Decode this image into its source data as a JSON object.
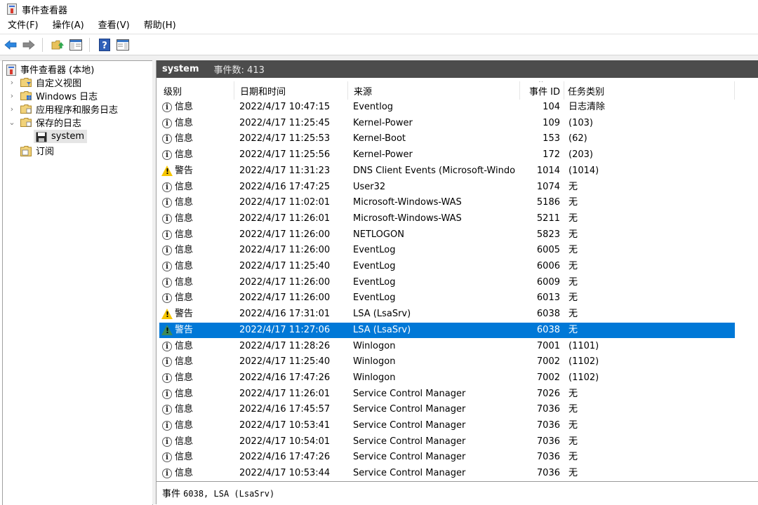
{
  "window": {
    "title": "事件查看器"
  },
  "menu": [
    "文件(F)",
    "操作(A)",
    "查看(V)",
    "帮助(H)"
  ],
  "toolbar": {
    "icons": [
      "back-arrow-icon",
      "forward-arrow-icon",
      "up-folder-icon",
      "show-hide-console-tree-icon",
      "help-icon",
      "show-hide-action-pane-icon"
    ]
  },
  "tree": {
    "root": "事件查看器 (本地)",
    "items": [
      {
        "label": "自定义视图",
        "expander": "›"
      },
      {
        "label": "Windows 日志",
        "expander": "›"
      },
      {
        "label": "应用程序和服务日志",
        "expander": "›"
      },
      {
        "label": "保存的日志",
        "expander": "⌄"
      },
      {
        "label": "system",
        "expander": ""
      },
      {
        "label": "订阅",
        "expander": ""
      }
    ]
  },
  "log_header": {
    "name": "system",
    "count": "事件数: 413"
  },
  "columns": [
    "级别",
    "日期和时间",
    "来源",
    "事件 ID",
    "任务类别"
  ],
  "rows": [
    {
      "level": "信息",
      "type": "info",
      "datetime": "2022/4/17 10:47:15",
      "source": "Eventlog",
      "id": "104",
      "task": "日志清除"
    },
    {
      "level": "信息",
      "type": "info",
      "datetime": "2022/4/17 11:25:45",
      "source": "Kernel-Power",
      "id": "109",
      "task": "(103)"
    },
    {
      "level": "信息",
      "type": "info",
      "datetime": "2022/4/17 11:25:53",
      "source": "Kernel-Boot",
      "id": "153",
      "task": "(62)"
    },
    {
      "level": "信息",
      "type": "info",
      "datetime": "2022/4/17 11:25:56",
      "source": "Kernel-Power",
      "id": "172",
      "task": "(203)"
    },
    {
      "level": "警告",
      "type": "warn",
      "datetime": "2022/4/17 11:31:23",
      "source": "DNS Client Events (Microsoft-Windo...",
      "id": "1014",
      "task": "(1014)"
    },
    {
      "level": "信息",
      "type": "info",
      "datetime": "2022/4/16 17:47:25",
      "source": "User32",
      "id": "1074",
      "task": "无"
    },
    {
      "level": "信息",
      "type": "info",
      "datetime": "2022/4/17 11:02:01",
      "source": "Microsoft-Windows-WAS",
      "id": "5186",
      "task": "无"
    },
    {
      "level": "信息",
      "type": "info",
      "datetime": "2022/4/17 11:26:01",
      "source": "Microsoft-Windows-WAS",
      "id": "5211",
      "task": "无"
    },
    {
      "level": "信息",
      "type": "info",
      "datetime": "2022/4/17 11:26:00",
      "source": "NETLOGON",
      "id": "5823",
      "task": "无"
    },
    {
      "level": "信息",
      "type": "info",
      "datetime": "2022/4/17 11:26:00",
      "source": "EventLog",
      "id": "6005",
      "task": "无"
    },
    {
      "level": "信息",
      "type": "info",
      "datetime": "2022/4/17 11:25:40",
      "source": "EventLog",
      "id": "6006",
      "task": "无"
    },
    {
      "level": "信息",
      "type": "info",
      "datetime": "2022/4/17 11:26:00",
      "source": "EventLog",
      "id": "6009",
      "task": "无"
    },
    {
      "level": "信息",
      "type": "info",
      "datetime": "2022/4/17 11:26:00",
      "source": "EventLog",
      "id": "6013",
      "task": "无"
    },
    {
      "level": "警告",
      "type": "warn",
      "datetime": "2022/4/16 17:31:01",
      "source": "LSA (LsaSrv)",
      "id": "6038",
      "task": "无"
    },
    {
      "level": "警告",
      "type": "warn",
      "datetime": "2022/4/17 11:27:06",
      "source": "LSA (LsaSrv)",
      "id": "6038",
      "task": "无",
      "selected": true
    },
    {
      "level": "信息",
      "type": "info",
      "datetime": "2022/4/17 11:28:26",
      "source": "Winlogon",
      "id": "7001",
      "task": "(1101)"
    },
    {
      "level": "信息",
      "type": "info",
      "datetime": "2022/4/17 11:25:40",
      "source": "Winlogon",
      "id": "7002",
      "task": "(1102)"
    },
    {
      "level": "信息",
      "type": "info",
      "datetime": "2022/4/16 17:47:26",
      "source": "Winlogon",
      "id": "7002",
      "task": "(1102)"
    },
    {
      "level": "信息",
      "type": "info",
      "datetime": "2022/4/17 11:26:01",
      "source": "Service Control Manager",
      "id": "7026",
      "task": "无"
    },
    {
      "level": "信息",
      "type": "info",
      "datetime": "2022/4/16 17:45:57",
      "source": "Service Control Manager",
      "id": "7036",
      "task": "无"
    },
    {
      "level": "信息",
      "type": "info",
      "datetime": "2022/4/17 10:53:41",
      "source": "Service Control Manager",
      "id": "7036",
      "task": "无"
    },
    {
      "level": "信息",
      "type": "info",
      "datetime": "2022/4/17 10:54:01",
      "source": "Service Control Manager",
      "id": "7036",
      "task": "无"
    },
    {
      "level": "信息",
      "type": "info",
      "datetime": "2022/4/16 17:47:26",
      "source": "Service Control Manager",
      "id": "7036",
      "task": "无"
    },
    {
      "level": "信息",
      "type": "info",
      "datetime": "2022/4/17 10:53:44",
      "source": "Service Control Manager",
      "id": "7036",
      "task": "无"
    }
  ],
  "status": {
    "prefix": "事件",
    "detail": "6038, LSA (LsaSrv)"
  },
  "colors": {
    "selection": "#0078d7",
    "header_bar": "#4c4c4c",
    "warning": "#f7c600"
  }
}
